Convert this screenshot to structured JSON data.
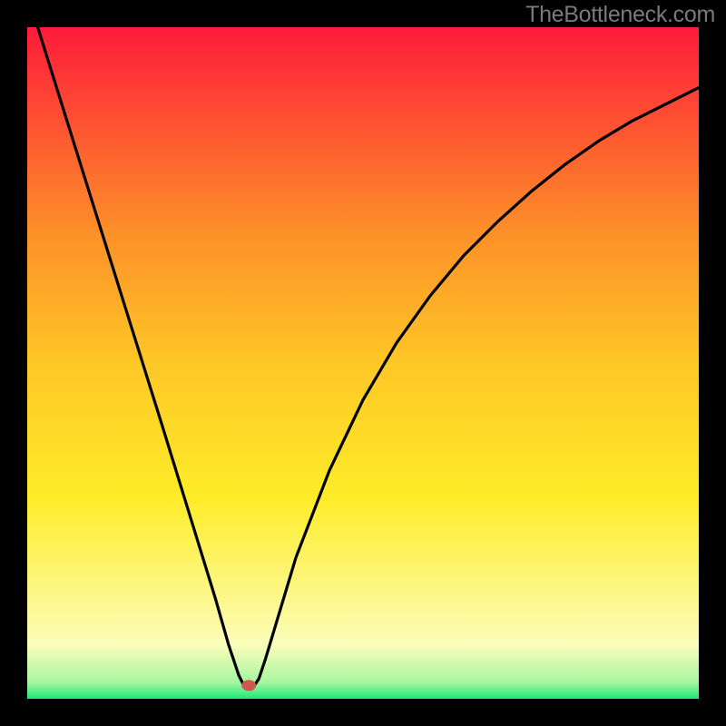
{
  "watermark": "TheBottleneck.com",
  "chart_data": {
    "type": "line",
    "title": "",
    "xlabel": "",
    "ylabel": "",
    "xlim": [
      0,
      100
    ],
    "ylim": [
      0,
      100
    ],
    "series": [
      {
        "name": "curve",
        "x": [
          0,
          5,
          10,
          15,
          20,
          24,
          28,
          30,
          31.5,
          32.5,
          33.5,
          34.5,
          35.5,
          37,
          40,
          45,
          50,
          55,
          60,
          65,
          70,
          75,
          80,
          85,
          90,
          95,
          100
        ],
        "values": [
          105,
          89,
          73,
          57,
          41,
          28,
          15,
          8,
          3.5,
          1.5,
          1.5,
          3,
          6,
          11,
          21,
          34,
          44.5,
          53,
          60,
          66,
          71,
          75.5,
          79.5,
          83,
          86,
          88.5,
          91
        ]
      }
    ],
    "marker": {
      "x": 33,
      "y": 2,
      "color": "#cf574d"
    },
    "colors": {
      "gradient_top": "#fe1b3a",
      "gradient_mid1": "#fd8e29",
      "gradient_mid2": "#fec726",
      "gradient_mid3": "#feec28",
      "gradient_bottom_fade": "#fbfdba",
      "green_band": "#20e77a",
      "curve": "#000000",
      "background": "#000000",
      "watermark": "#7a7a7a"
    }
  }
}
